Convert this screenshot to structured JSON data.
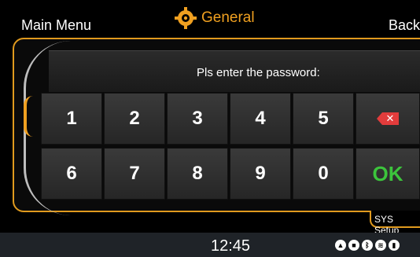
{
  "header": {
    "main_menu_label": "Main Menu",
    "title": "General",
    "back_label": "Back"
  },
  "prompt": {
    "text": "Pls enter the password:"
  },
  "keypad": {
    "row1": [
      "1",
      "2",
      "3",
      "4",
      "5"
    ],
    "row2": [
      "6",
      "7",
      "8",
      "9",
      "0"
    ],
    "ok_label": "OK",
    "backspace_icon": "backspace-icon"
  },
  "tab": {
    "label": "SYS Setup"
  },
  "status": {
    "time": "12:45",
    "icons": [
      "navigation-icon",
      "camera-icon",
      "bluetooth-icon",
      "wifi-icon",
      "signal-icon"
    ]
  },
  "colors": {
    "accent": "#e09a1e",
    "title": "#f0a020",
    "ok": "#3cc43c",
    "delete": "#e23c3c"
  }
}
